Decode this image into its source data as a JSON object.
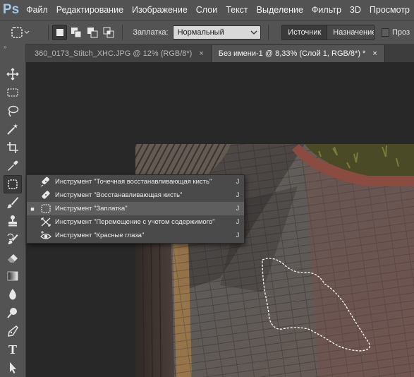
{
  "app": {
    "logo": "Ps"
  },
  "menu": [
    "Файл",
    "Редактирование",
    "Изображение",
    "Слои",
    "Текст",
    "Выделение",
    "Фильтр",
    "3D",
    "Просмотр"
  ],
  "options": {
    "patch_label": "Заплатка:",
    "patch_mode": "Нормальный",
    "source_label": "Источник",
    "destination_label": "Назначение",
    "transparent_label": "Проз"
  },
  "tabs": [
    {
      "label": "360_0173_Stitch_XHC.JPG @ 12% (RGB/8*)",
      "close": "×",
      "active": false
    },
    {
      "label": "Без имени-1 @ 8,33% (Слой 1, RGB/8*) *",
      "close": "×",
      "active": true
    }
  ],
  "flyout": {
    "items": [
      {
        "label": "Инструмент \"Точечная восстанавливающая кисть\"",
        "key": "J",
        "icon": "spot-healing-brush-icon",
        "selected": false
      },
      {
        "label": "Инструмент \"Восстанавливающая кисть\"",
        "key": "J",
        "icon": "healing-brush-icon",
        "selected": false
      },
      {
        "label": "Инструмент \"Заплатка\"",
        "key": "J",
        "icon": "patch-icon",
        "selected": true,
        "bullet": "■"
      },
      {
        "label": "Инструмент \"Перемещение с учетом содержимого\"",
        "key": "J",
        "icon": "content-aware-move-icon",
        "selected": false
      },
      {
        "label": "Инструмент \"Красные глаза\"",
        "key": "J",
        "icon": "red-eye-icon",
        "selected": false
      }
    ]
  },
  "toolbar": {
    "collapse": "»",
    "tools": [
      "move-icon",
      "marquee-icon",
      "lasso-icon",
      "magic-wand-icon",
      "crop-icon",
      "eyedropper-icon",
      "patch-icon",
      "brush-icon",
      "stamp-icon",
      "history-brush-icon",
      "eraser-icon",
      "gradient-icon",
      "blur-icon",
      "dodge-icon",
      "pen-icon",
      "type-icon",
      "path-selection-icon"
    ],
    "type_glyph": "T"
  },
  "colors": {
    "accent": "#9fc9ee",
    "ui": "#535353",
    "bg": "#282828"
  }
}
